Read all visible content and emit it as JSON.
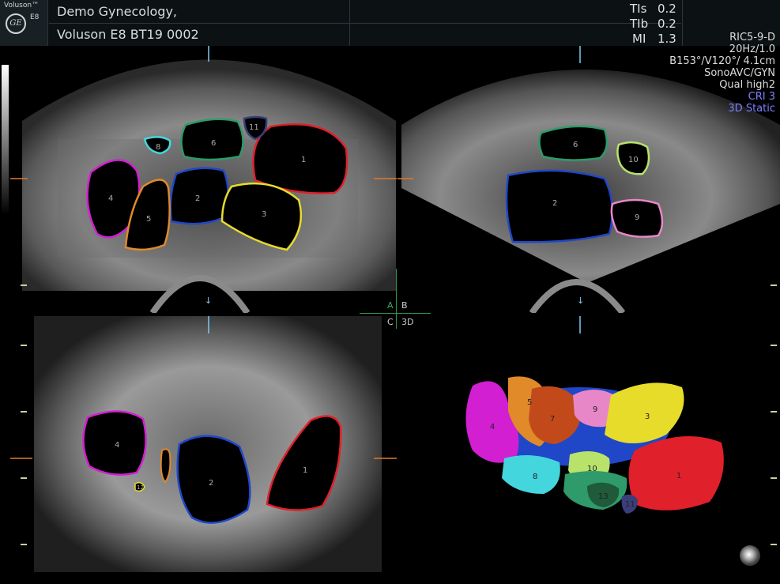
{
  "header": {
    "brand": "Voluson™",
    "brand_model": "E8",
    "logo_text": "GE",
    "title_line1": "Demo Gynecology,",
    "title_line2": "Voluson E8 BT19 0002",
    "tis_label": "TIs",
    "tis_value": "0.2",
    "tib_label": "TIb",
    "tib_value": "0.2",
    "mi_label": "MI",
    "mi_value": "1.3"
  },
  "info": {
    "lines": [
      "RIC5-9-D",
      "20Hz/1.0",
      "B153°/V120°/ 4.1cm",
      "SonoAVC/GYN",
      "Qual high2"
    ],
    "blue_lines": [
      "CRI 3",
      "3D Static"
    ]
  },
  "quadrants": {
    "a": "A",
    "b": "B",
    "c": "C",
    "d": "3D"
  },
  "panel_a": {
    "labels": [
      "1",
      "2",
      "3",
      "4",
      "5",
      "6",
      "8",
      "11"
    ]
  },
  "panel_b": {
    "labels": [
      "2",
      "6",
      "9",
      "10"
    ]
  },
  "panel_c": {
    "labels": [
      "1",
      "2",
      "4",
      "12"
    ]
  },
  "panel_d": {
    "labels": [
      "1",
      "3",
      "4",
      "5",
      "7",
      "8",
      "9",
      "10",
      "11",
      "13"
    ]
  },
  "colors": {
    "red": "#e0202a",
    "blue": "#1f47c8",
    "yellow": "#e8dc2a",
    "magenta": "#d21fd2",
    "orange": "#e08a2a",
    "green": "#2f9a6a",
    "cyan": "#43d6dc",
    "lightgreen": "#b8e26a",
    "pink": "#e887c8",
    "navy": "#3a3e7a",
    "darkgreen": "#1f5a3a"
  }
}
